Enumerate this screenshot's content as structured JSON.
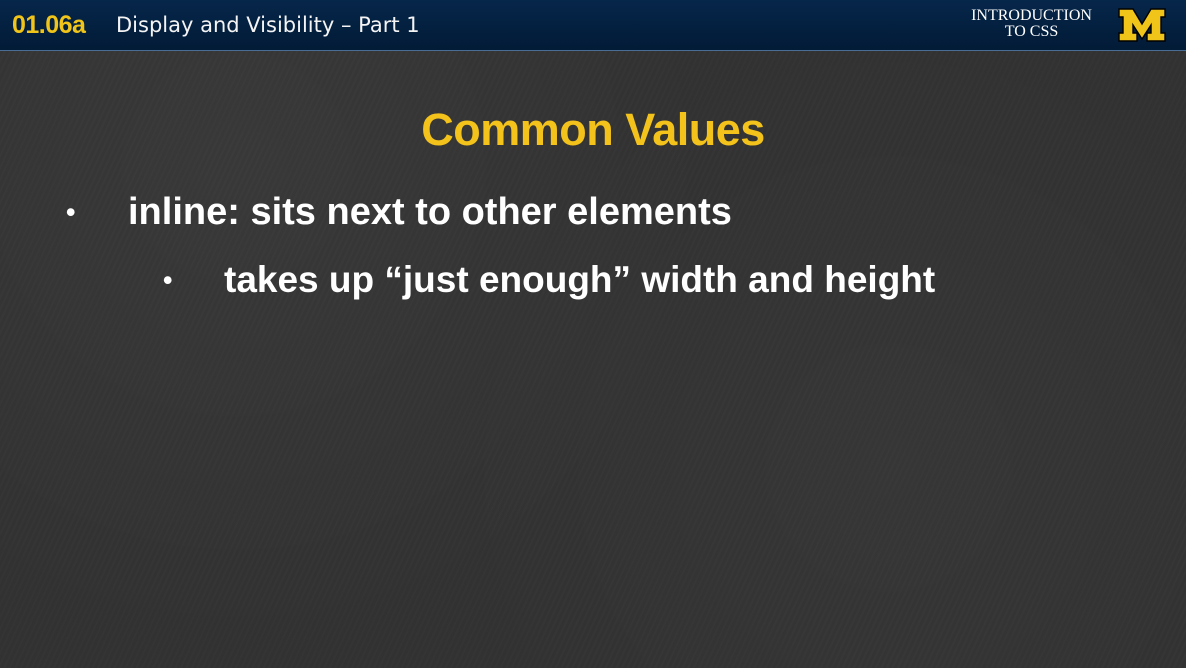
{
  "header": {
    "lesson_code": "01.06a",
    "lesson_title": "Display and Visibility – Part 1",
    "course_title_line_1": "INTRODUCTION",
    "course_title_line_2": "TO CSS",
    "logo_text": "M",
    "colors": {
      "header_background": "#06264a",
      "accent": "#f0c419",
      "logo_fill": "#f0c419"
    }
  },
  "slide": {
    "title": "Common Values",
    "bullets": [
      {
        "marker": "•",
        "text": "inline: sits next to other elements"
      },
      {
        "marker": "•",
        "text": "takes up “just enough” width and height"
      }
    ],
    "colors": {
      "background": "#323232",
      "title": "#f3c21b",
      "body_text": "#ffffff"
    }
  }
}
